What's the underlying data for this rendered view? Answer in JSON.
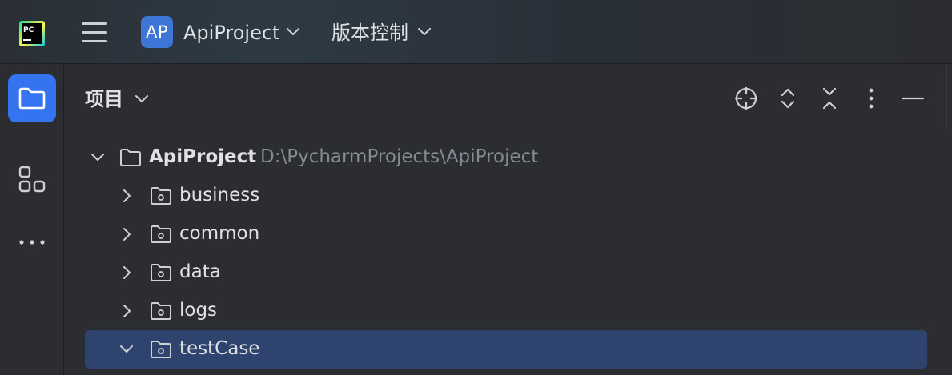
{
  "titlebar": {
    "logo_text": "PC",
    "project_badge": "AP",
    "project_name": "ApiProject",
    "vcs_label": "版本控制"
  },
  "panel": {
    "title": "项目"
  },
  "tree": {
    "root": {
      "name": "ApiProject",
      "path": "D:\\PycharmProjects\\ApiProject"
    },
    "items": [
      {
        "name": "business"
      },
      {
        "name": "common"
      },
      {
        "name": "data"
      },
      {
        "name": "logs"
      },
      {
        "name": "testCase"
      }
    ]
  },
  "colors": {
    "accent": "#3574f0",
    "selection": "#2e436e",
    "text": "#dfe1e5",
    "muted": "#868a91",
    "background": "#2b2d30"
  },
  "icons": {
    "app": "pycharm-logo-icon",
    "menu": "hamburger-menu-icon",
    "project_tool": "folder-icon",
    "structure_tool": "structure-icon",
    "more_tools": "more-horizontal-icon",
    "locate": "crosshair-icon",
    "expand_all": "expand-all-icon",
    "collapse_all": "collapse-all-icon",
    "options": "more-vertical-icon",
    "hide": "minimize-icon"
  }
}
